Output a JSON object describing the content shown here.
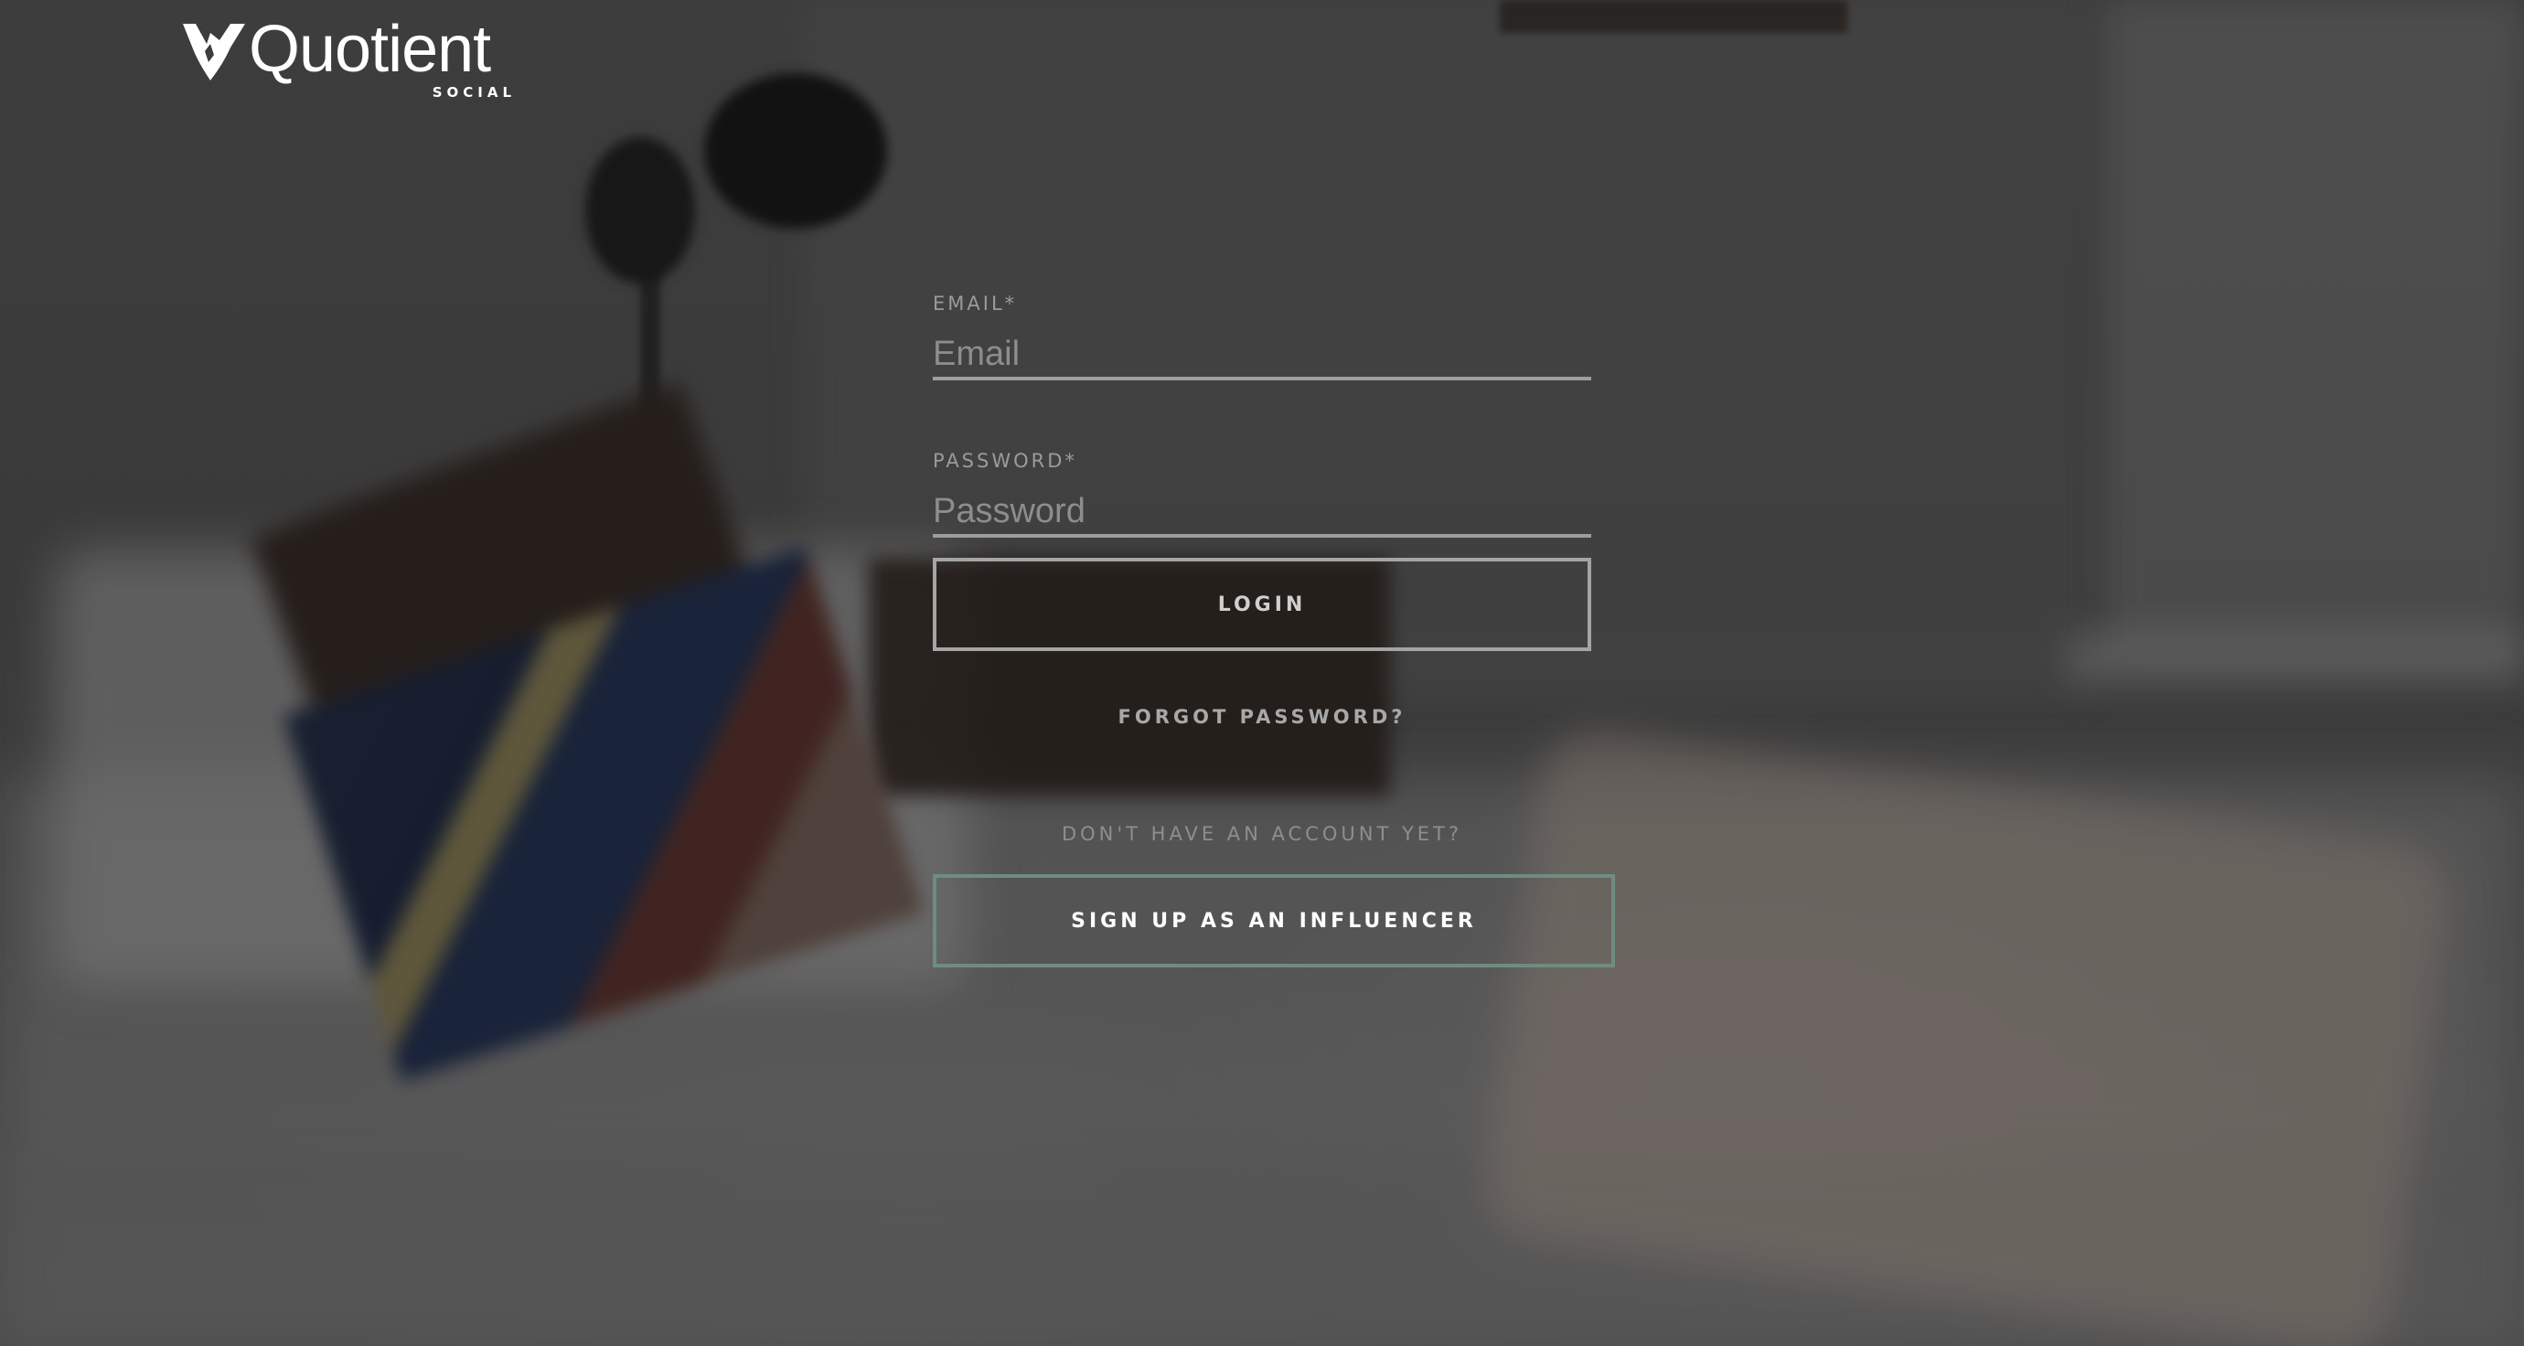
{
  "brand": {
    "name": "Quotient",
    "sub": "SOCIAL",
    "logo_icon": "shield-check-icon"
  },
  "login_form": {
    "email": {
      "label": "EMAIL*",
      "placeholder": "Email",
      "value": ""
    },
    "password": {
      "label": "PASSWORD*",
      "placeholder": "Password",
      "value": ""
    },
    "login_label": "LOGIN",
    "forgot_label": "FORGOT PASSWORD?",
    "no_account_text": "DON'T HAVE AN ACCOUNT YET?",
    "signup_label": "SIGN UP AS AN INFLUENCER"
  },
  "colors": {
    "signup_border": "#6f8c80",
    "input_underline": "#9d9d9d",
    "text_muted": "#9b9b9b"
  }
}
